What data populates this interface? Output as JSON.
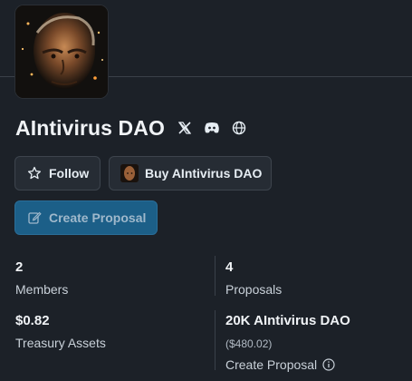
{
  "dao": {
    "name": "AIntivirus DAO"
  },
  "social": {
    "x_icon": "x-icon",
    "discord_icon": "discord-icon",
    "web_icon": "globe-icon"
  },
  "buttons": {
    "follow": "Follow",
    "buy": "Buy AIntivirus DAO",
    "create_proposal": "Create Proposal"
  },
  "stats": {
    "members_value": "2",
    "members_label": "Members",
    "proposals_value": "4",
    "proposals_label": "Proposals",
    "treasury_value": "$0.82",
    "treasury_label": "Treasury Assets",
    "token_value": "20K AIntivirus DAO",
    "token_usd": "($480.02)",
    "token_link": "Create Proposal"
  },
  "colors": {
    "background": "#1c2128",
    "button_bg": "#262c34",
    "primary_button": "#1c5f88"
  }
}
